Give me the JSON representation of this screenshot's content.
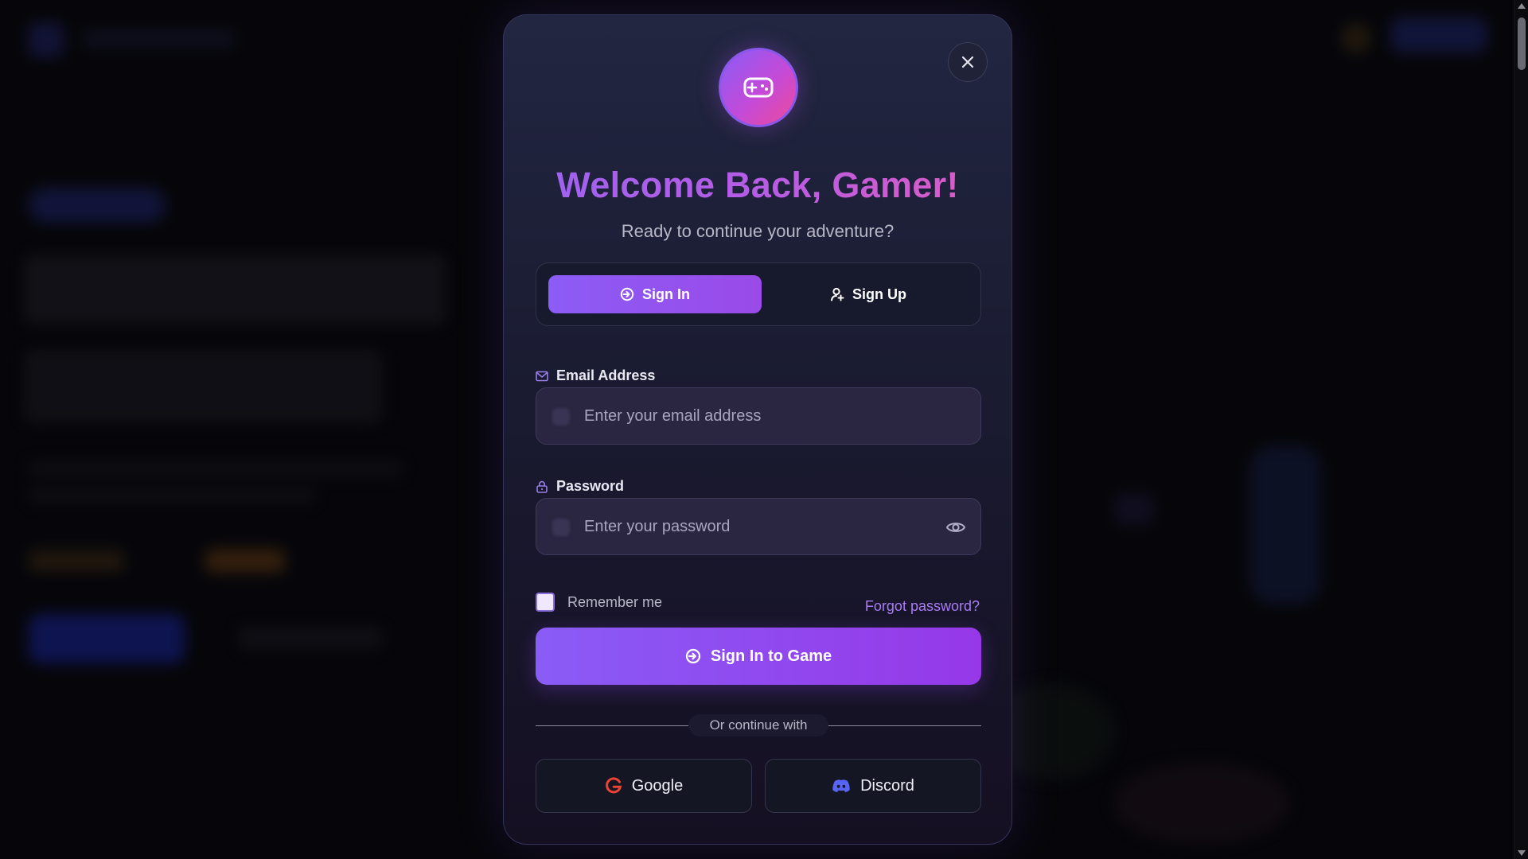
{
  "modal": {
    "title": "Welcome Back, Gamer!",
    "subtitle": "Ready to continue your adventure?",
    "close_label": "×"
  },
  "tabs": [
    {
      "label": "Sign In",
      "icon": "login-icon",
      "active": true
    },
    {
      "label": "Sign Up",
      "icon": "user-plus-icon",
      "active": false
    }
  ],
  "form": {
    "email": {
      "label": "Email Address",
      "placeholder": "Enter your email address",
      "value": "",
      "icon": "mail-icon"
    },
    "password": {
      "label": "Password",
      "placeholder": "Enter your password",
      "value": "",
      "icon": "lock-icon"
    },
    "remember_label": "Remember me",
    "remember_checked": false,
    "forgot_label": "Forgot password?",
    "submit_label": "Sign In to Game"
  },
  "divider_text": "Or continue with",
  "social": [
    {
      "label": "Google",
      "icon": "google-icon"
    },
    {
      "label": "Discord",
      "icon": "discord-icon"
    }
  ],
  "colors": {
    "accent": "#8a5cf6",
    "accent_pink": "#ee4a9a",
    "link": "#a87cf4",
    "google": "#ea4335",
    "discord": "#5865f2"
  }
}
